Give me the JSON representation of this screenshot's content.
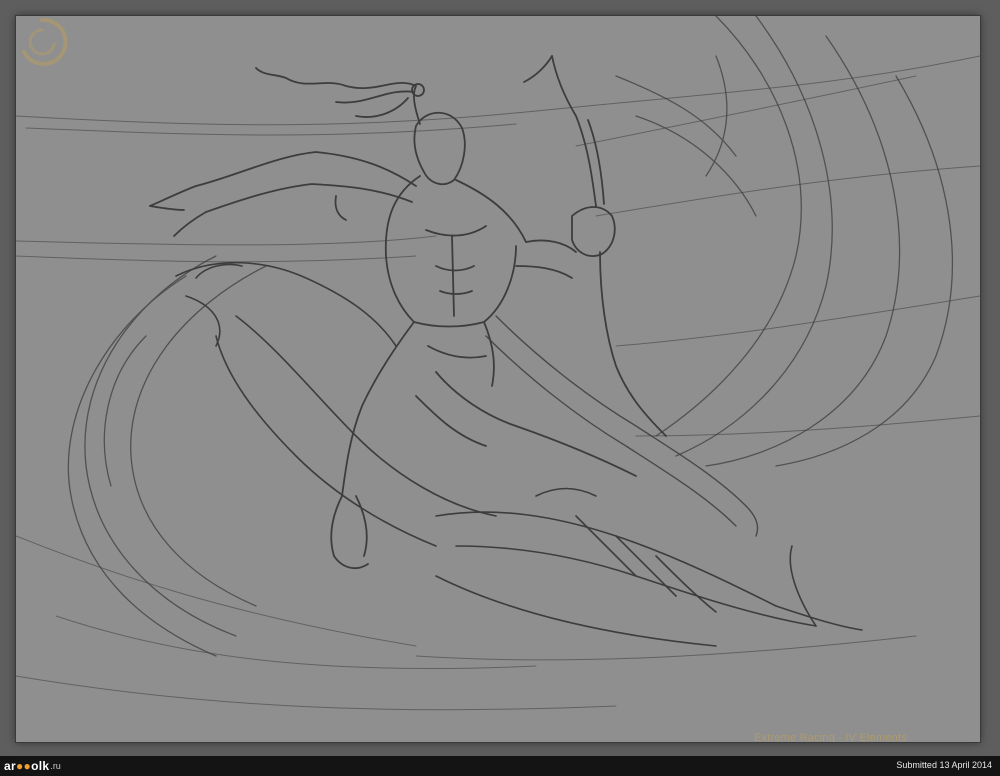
{
  "artwork": {
    "caption": "Extreme Racing - IV Elements",
    "watermark_icon": "swirl-logo-icon",
    "background_color": "#8f8f8f",
    "line_color": "#3c3c3c"
  },
  "footer": {
    "site_logo": "ar🐑olk.ru",
    "site_logo_main": "ar",
    "site_logo_mid": "olk",
    "site_logo_suffix": ".ru",
    "submitted_text": "Submitted 13 April 2014"
  }
}
